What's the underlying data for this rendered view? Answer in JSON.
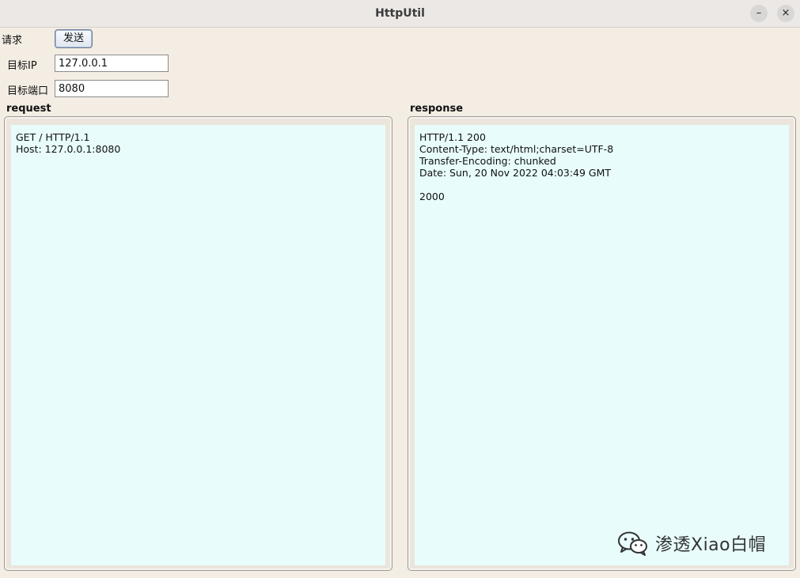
{
  "window": {
    "title": "HttpUtil",
    "minimize_glyph": "–",
    "close_glyph": "×"
  },
  "form": {
    "request_label": "请求",
    "send_button": "发送",
    "ip_label": "目标IP",
    "ip_value": "127.0.0.1",
    "port_label": "目标端口",
    "port_value": "8080"
  },
  "request": {
    "title": "request",
    "text": "GET / HTTP/1.1\nHost: 127.0.0.1:8080"
  },
  "response": {
    "title": "response",
    "text": "HTTP/1.1 200\nContent-Type: text/html;charset=UTF-8\nTransfer-Encoding: chunked\nDate: Sun, 20 Nov 2022 04:03:49 GMT\n\n2000"
  },
  "watermark": {
    "icon": "wechat-icon",
    "text": "渗透Xiao白帽"
  }
}
